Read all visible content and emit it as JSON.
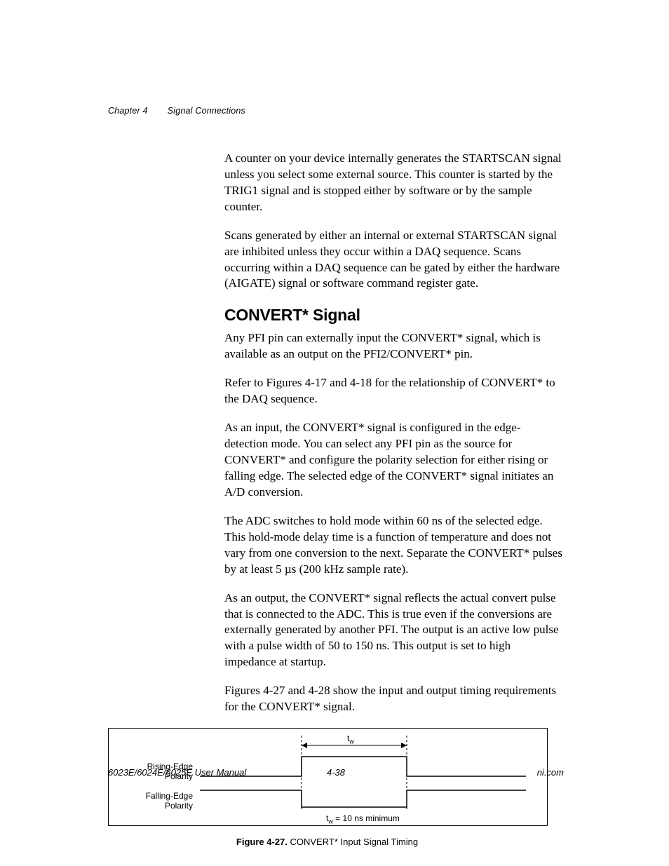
{
  "header": {
    "chapter": "Chapter 4",
    "section": "Signal Connections"
  },
  "paragraphs": {
    "p1": "A counter on your device internally generates the STARTSCAN signal unless you select some external source. This counter is started by the TRIG1 signal and is stopped either by software or by the sample counter.",
    "p2": "Scans generated by either an internal or external STARTSCAN signal are inhibited unless they occur within a DAQ sequence. Scans occurring within a DAQ sequence can be gated by either the hardware (AIGATE) signal or software command register gate.",
    "h2": "CONVERT* Signal",
    "p3": "Any PFI pin can externally input the CONVERT* signal, which is available as an output on the PFI2/CONVERT* pin.",
    "p4": "Refer to Figures 4-17 and 4-18 for the relationship of CONVERT* to the DAQ sequence.",
    "p5": "As an input, the CONVERT* signal is configured in the edge-detection mode. You can select any PFI pin as the source for CONVERT* and configure the polarity selection for either rising or falling edge. The selected edge of the CONVERT* signal initiates an A/D conversion.",
    "p6": "The ADC switches to hold mode within 60 ns of the selected edge. This hold-mode delay time is a function of temperature and does not vary from one conversion to the next. Separate the CONVERT* pulses by at least 5 µs (200 kHz sample rate).",
    "p7": "As an output, the CONVERT* signal reflects the actual convert pulse that is connected to the ADC. This is true even if the conversions are externally generated by another PFI. The output is an active low pulse with a pulse width of 50 to 150 ns. This output is set to high impedance at startup.",
    "p8": "Figures 4-27 and 4-28 show the input and output timing requirements for the CONVERT* signal."
  },
  "figure": {
    "label_rising": "Rising-Edge\nPolarity",
    "label_falling": "Falling-Edge\nPolarity",
    "tw_symbol_html": "t",
    "tw_note": " = 10 ns minimum",
    "caption_bold": "Figure 4-27.",
    "caption_rest": "  CONVERT* Input Signal Timing"
  },
  "footer": {
    "left": "6023E/6024E/6025E User Manual",
    "center": "4-38",
    "right": "ni.com"
  }
}
